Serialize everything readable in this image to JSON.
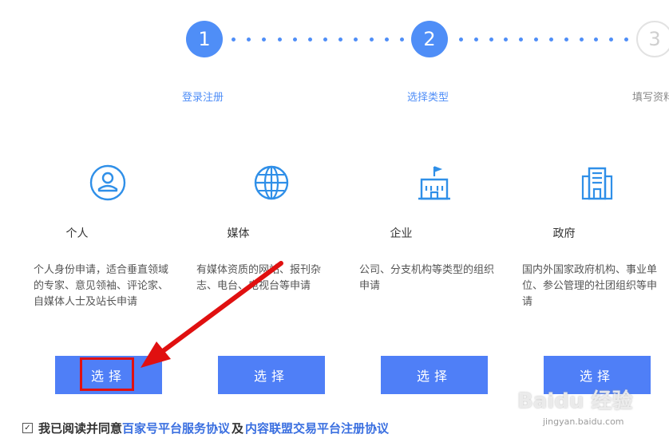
{
  "stepper": {
    "steps": [
      {
        "number": "1",
        "label": "登录注册",
        "state": "active"
      },
      {
        "number": "2",
        "label": "选择类型",
        "state": "active"
      },
      {
        "number": "3",
        "label": "填写资料",
        "state": "pending"
      }
    ],
    "active_color": "#4f8ef7",
    "pending_color": "#cfcfcf"
  },
  "types": [
    {
      "icon": "person-icon",
      "title": "个人",
      "desc": "个人身份申请，适合垂直领域的专家、意见领袖、评论家、自媒体人士及站长申请",
      "button": "选择"
    },
    {
      "icon": "globe-icon",
      "title": "媒体",
      "desc": "有媒体资质的网站、报刊杂志、电台、电视台等申请",
      "button": "选择"
    },
    {
      "icon": "company-building-icon",
      "title": "企业",
      "desc": "公司、分支机构等类型的组织申请",
      "button": "选择"
    },
    {
      "icon": "government-building-icon",
      "title": "政府",
      "desc": "国内外国家政府机构、事业单位、参公管理的社团组织等申请",
      "button": "选择"
    }
  ],
  "agreement": {
    "prefix": "我已阅读并同意",
    "link1": "百家号平台服务协议",
    "conj": "及",
    "link2": "内容联盟交易平台注册协议",
    "checked": true
  },
  "watermark": {
    "main": "Baidu 经验",
    "sub": "jingyan.baidu.com"
  },
  "colors": {
    "button": "#4f7ff7",
    "annotation": "#e01010",
    "link": "#3a6fe0"
  }
}
